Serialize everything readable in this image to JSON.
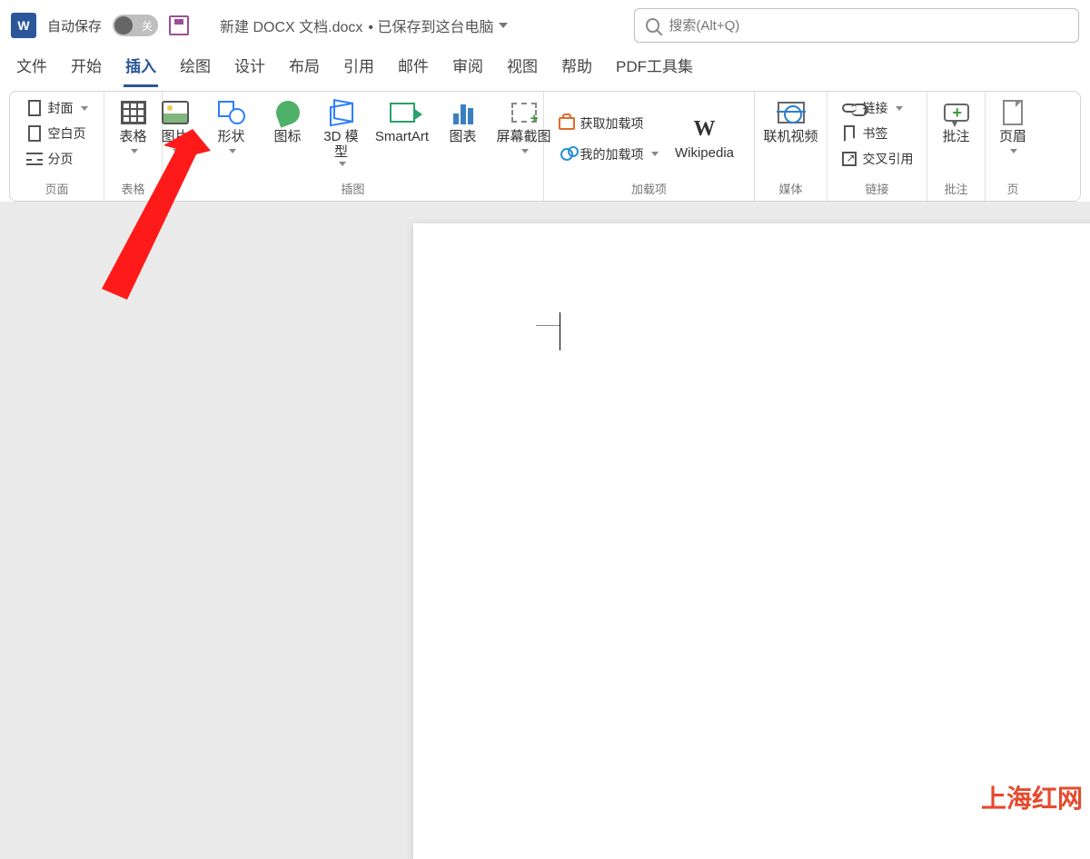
{
  "titlebar": {
    "autosave_label": "自动保存",
    "autosave_state": "关",
    "doc_name": "新建 DOCX 文档.docx",
    "doc_status": "已保存到这台电脑",
    "search_placeholder": "搜索(Alt+Q)"
  },
  "tabs": {
    "file": "文件",
    "home": "开始",
    "insert": "插入",
    "draw": "绘图",
    "design": "设计",
    "layout": "布局",
    "references": "引用",
    "mailings": "邮件",
    "review": "审阅",
    "view": "视图",
    "help": "帮助",
    "pdf": "PDF工具集"
  },
  "ribbon": {
    "pages": {
      "label": "页面",
      "cover": "封面",
      "blank": "空白页",
      "break": "分页"
    },
    "tables": {
      "label": "表格",
      "button": "表格"
    },
    "illustrations": {
      "label": "插图",
      "picture": "图片",
      "shapes": "形状",
      "icons": "图标",
      "models": "3D 模型",
      "smartart": "SmartArt",
      "chart": "图表",
      "screenshot": "屏幕截图"
    },
    "addins": {
      "label": "加载项",
      "get": "获取加载项",
      "my": "我的加载项",
      "wikipedia": "Wikipedia"
    },
    "media": {
      "label": "媒体",
      "video": "联机视频"
    },
    "links": {
      "label": "链接",
      "hyperlink": "链接",
      "bookmark": "书签",
      "crossref": "交叉引用"
    },
    "comments": {
      "label": "批注",
      "comment": "批注"
    },
    "headerfooter": {
      "label": "页",
      "header": "页眉"
    }
  },
  "watermark": "上海红网"
}
